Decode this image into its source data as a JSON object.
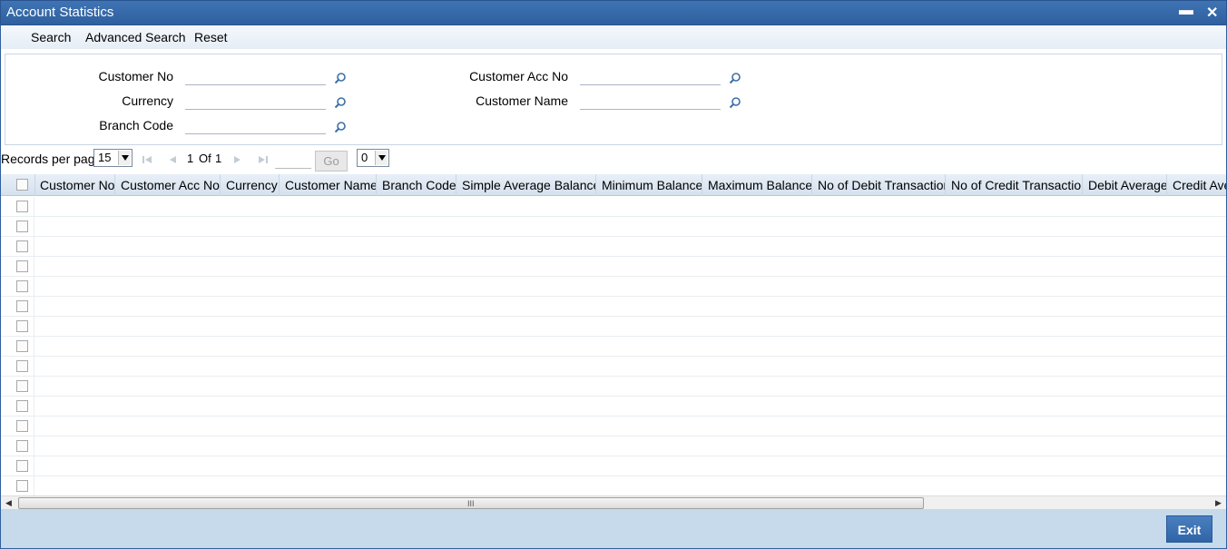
{
  "window": {
    "title": "Account Statistics",
    "minimize": "▬",
    "close": "✕"
  },
  "menu": {
    "search": "Search",
    "advanced_search": "Advanced Search",
    "reset": "Reset"
  },
  "search_fields": {
    "customer_no": {
      "label": "Customer No",
      "value": ""
    },
    "currency": {
      "label": "Currency",
      "value": ""
    },
    "branch_code": {
      "label": "Branch Code",
      "value": ""
    },
    "customer_acc_no": {
      "label": "Customer Acc No",
      "value": ""
    },
    "customer_name": {
      "label": "Customer Name",
      "value": ""
    }
  },
  "pager": {
    "records_per_page_label": "Records per page",
    "records_per_page": "15",
    "current_page": "1",
    "of_label": "Of",
    "total_pages": "1",
    "go_label": "Go",
    "go_value": "",
    "secondary_select": "0"
  },
  "table": {
    "columns": [
      "Customer No",
      "Customer Acc No",
      "Currency",
      "Customer Name",
      "Branch Code",
      "Simple Average Balance",
      "Minimum Balance",
      "Maximum Balance",
      "No of Debit Transaction",
      "No of Credit Transaction",
      "Debit Average",
      "Credit Average"
    ],
    "row_count": 15
  },
  "footer": {
    "exit_label": "Exit"
  },
  "icons": {
    "lookup": "magnifier-icon",
    "first": "first-page-icon",
    "prev": "prev-page-icon",
    "next": "next-page-icon",
    "last": "last-page-icon"
  },
  "colors": {
    "titlebar": "#3f74b4",
    "footer": "#c6daeb",
    "exit_button": "#2f64a7"
  }
}
